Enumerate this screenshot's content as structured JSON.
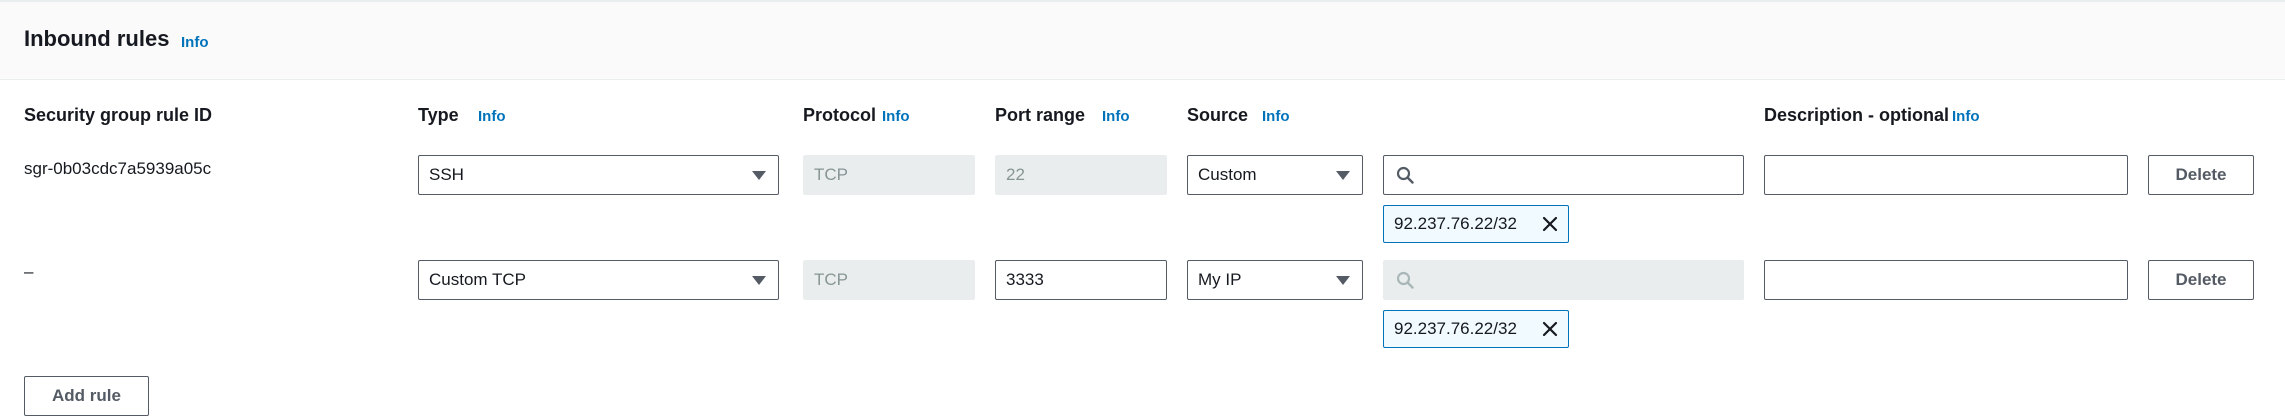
{
  "section": {
    "title": "Inbound rules",
    "info": "Info"
  },
  "columns": {
    "rule_id": "Security group rule ID",
    "type": "Type",
    "protocol": "Protocol",
    "port_range": "Port range",
    "source": "Source",
    "description": "Description - optional",
    "info": "Info"
  },
  "rules": [
    {
      "rule_id": "sgr-0b03cdc7a5939a05c",
      "type": "SSH",
      "protocol": "TCP",
      "port_range": "22",
      "source_type": "Custom",
      "source_search_value": "",
      "source_token": "92.237.76.22/32",
      "description": "",
      "delete_label": "Delete"
    },
    {
      "rule_id": "–",
      "type": "Custom TCP",
      "protocol": "TCP",
      "port_range": "3333",
      "source_type": "My IP",
      "source_search_value": "",
      "source_token": "92.237.76.22/32",
      "description": "",
      "delete_label": "Delete"
    }
  ],
  "add_rule_label": "Add rule",
  "icons": {
    "search": "search-icon",
    "remove": "close-icon",
    "dropdown": "caret-down-icon"
  },
  "colors": {
    "link": "#0073bb",
    "token_border": "#0073bb",
    "token_bg": "#f1faff",
    "disabled_bg": "#eaeded",
    "border": "#545b64"
  }
}
